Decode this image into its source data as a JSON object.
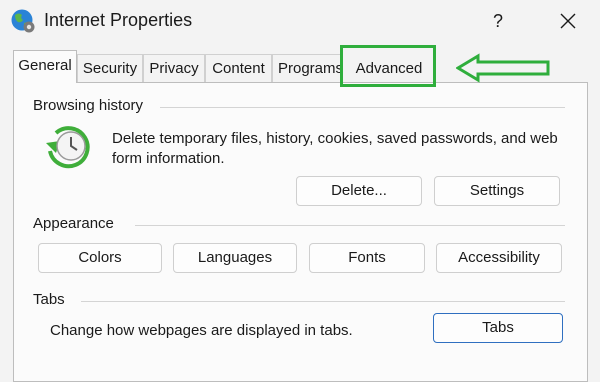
{
  "window": {
    "title": "Internet Properties",
    "help_label": "?",
    "icon": "globe-settings-icon"
  },
  "tabs": [
    {
      "label": "General",
      "active": true
    },
    {
      "label": "Security",
      "active": false
    },
    {
      "label": "Privacy",
      "active": false
    },
    {
      "label": "Content",
      "active": false
    },
    {
      "label": "Programs",
      "active": false
    },
    {
      "label": "Advanced",
      "active": false
    }
  ],
  "annotation": {
    "highlight_color": "#2fae3c",
    "highlighted_tab": "Advanced"
  },
  "browsing_history": {
    "label": "Browsing history",
    "description": "Delete temporary files, history, cookies, saved passwords, and web form information.",
    "icon": "clock-refresh-icon",
    "delete_label": "Delete...",
    "settings_label": "Settings"
  },
  "appearance": {
    "label": "Appearance",
    "colors_label": "Colors",
    "languages_label": "Languages",
    "fonts_label": "Fonts",
    "accessibility_label": "Accessibility"
  },
  "tabs_group": {
    "label": "Tabs",
    "description": "Change how webpages are displayed in tabs.",
    "button_label": "Tabs"
  },
  "colors": {
    "accent": "#2f6fc0",
    "background": "#f3f3f3"
  }
}
